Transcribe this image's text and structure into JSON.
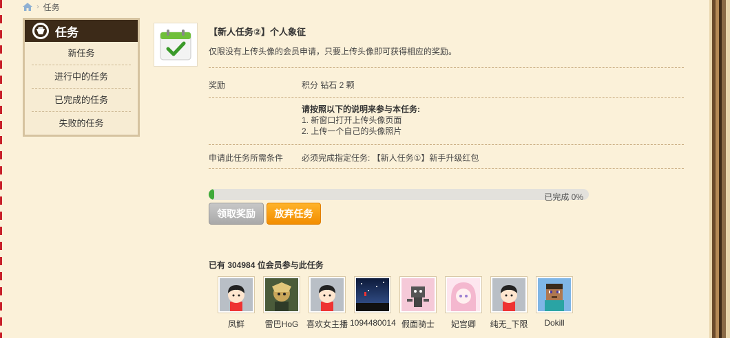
{
  "breadcrumb": {
    "current": "任务"
  },
  "sidebar": {
    "title": "任务",
    "items": [
      {
        "label": "新任务"
      },
      {
        "label": "进行中的任务"
      },
      {
        "label": "已完成的任务"
      },
      {
        "label": "失败的任务"
      }
    ]
  },
  "task": {
    "title": "【新人任务②】个人象征",
    "description": "仅限没有上传头像的会员申请，只要上传头像即可获得相应的奖励。",
    "reward_label": "奖励",
    "reward_value": "积分 钻石 2 颗",
    "instructions_title": "请按照以下的说明来参与本任务:",
    "instructions": [
      "1. 新窗口打开上传头像页面",
      "2. 上传一个自己的头像照片"
    ],
    "condition_label": "申请此任务所需条件",
    "condition_value": "必须完成指定任务: 【新人任务①】新手升级红包",
    "progress_percent": 0,
    "progress_text": "已完成 0%",
    "claim_button": "领取奖励",
    "abandon_button": "放弃任务"
  },
  "participants": {
    "summary": "已有 304984 位会员参与此任务",
    "users": [
      {
        "name": "凤鲜",
        "avatar": "default-avatar-icon"
      },
      {
        "name": "雷巴HoG",
        "avatar": "anime-warrior-avatar"
      },
      {
        "name": "喜欢女主播",
        "avatar": "default-avatar-icon"
      },
      {
        "name": "1094480014",
        "avatar": "night-sky-avatar"
      },
      {
        "name": "假面骑士",
        "avatar": "sketch-robot-avatar"
      },
      {
        "name": "妃宫卿",
        "avatar": "pink-anime-girl-avatar"
      },
      {
        "name": "纯无_下限",
        "avatar": "default-avatar-icon"
      },
      {
        "name": "Dokill",
        "avatar": "minecraft-avatar"
      }
    ]
  }
}
